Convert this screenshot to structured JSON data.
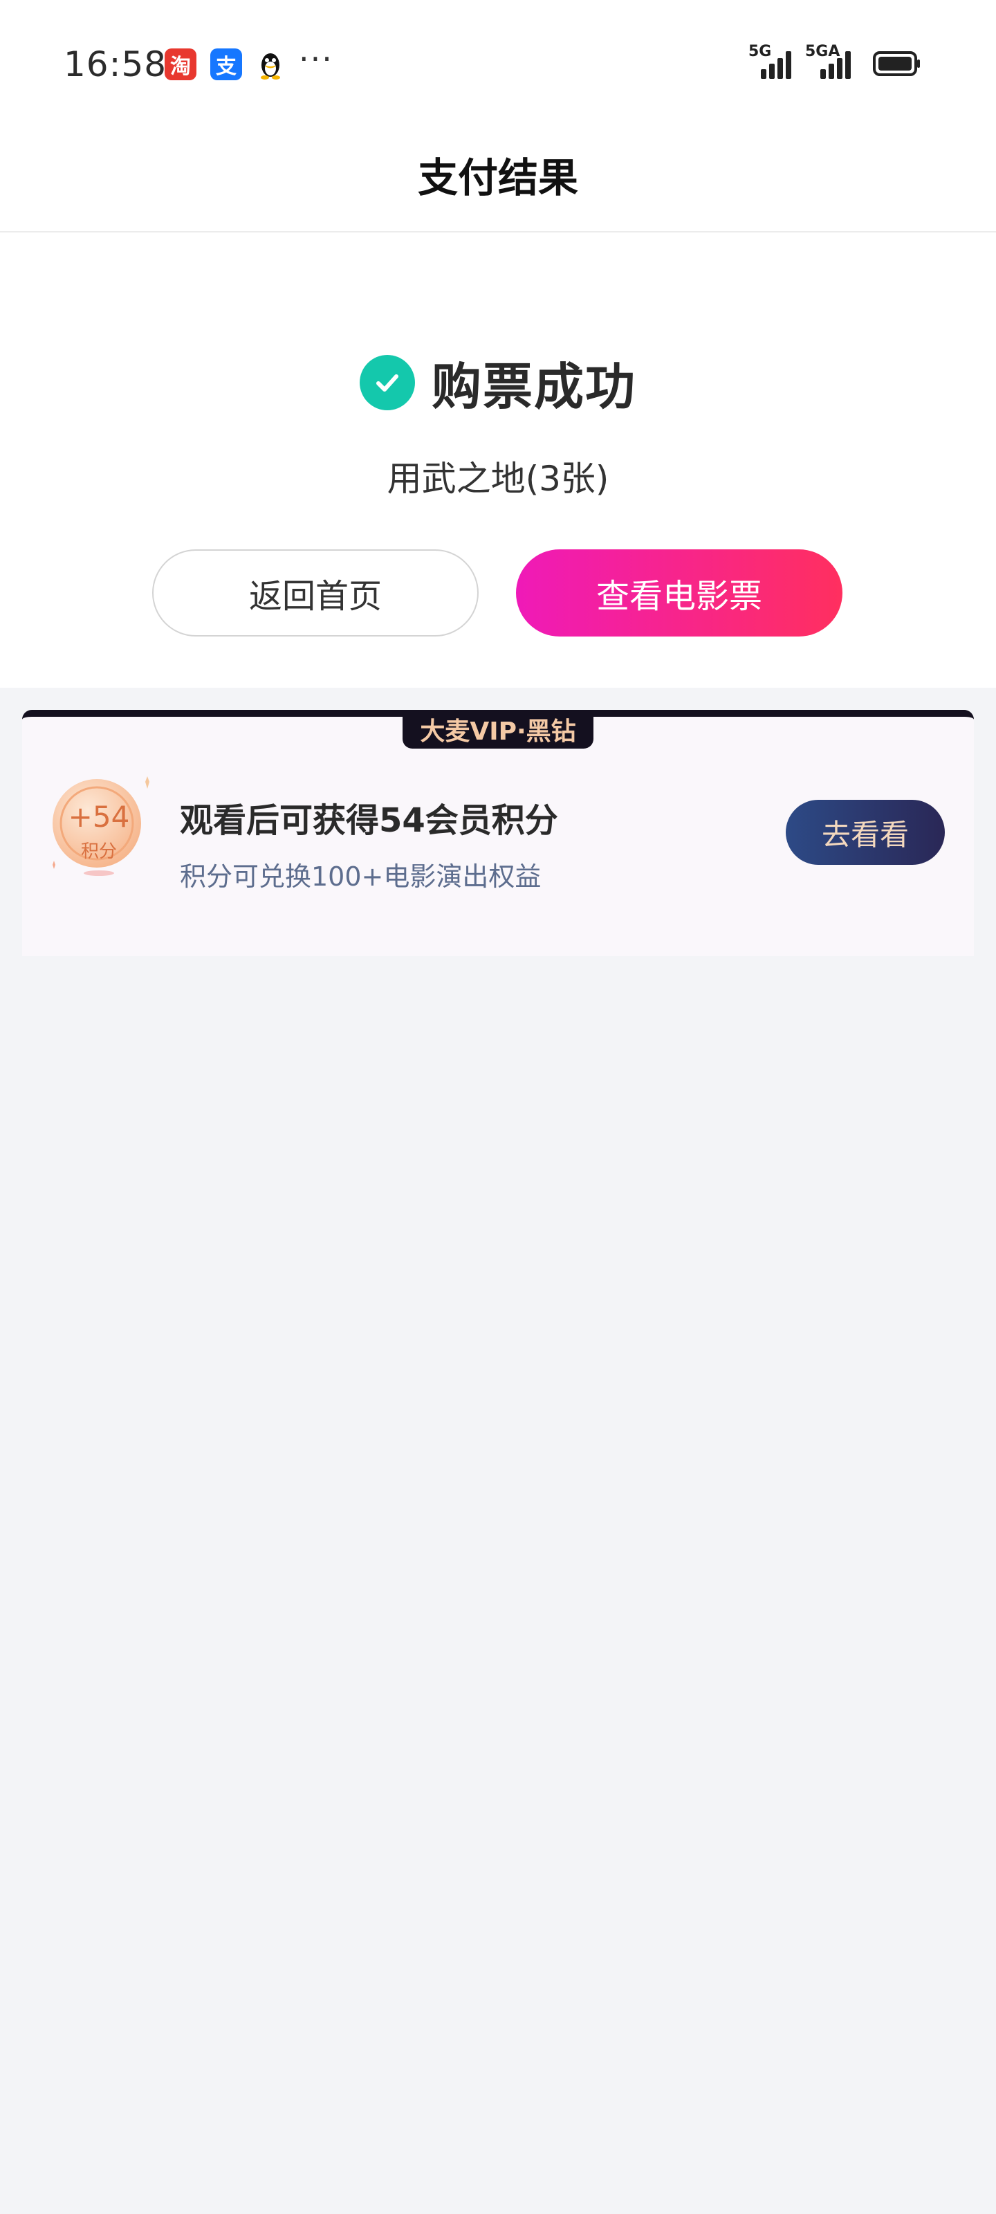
{
  "status_bar": {
    "time": "16:58",
    "app_icons": [
      "taobao-icon",
      "alipay-icon",
      "qq-icon"
    ],
    "more": "···",
    "network_1": "5G",
    "network_2": "5GA"
  },
  "header": {
    "title": "支付结果"
  },
  "result": {
    "status_text": "购票成功",
    "movie_info": "用武之地(3张)",
    "home_button": "返回首页",
    "ticket_button": "查看电影票"
  },
  "vip_card": {
    "tag": "大麦VIP·黑钻",
    "coin_points": "+54",
    "coin_label": "积分",
    "title": "观看后可获得54会员积分",
    "subtitle": "积分可兑换100+电影演出权益",
    "button": "去看看"
  },
  "colors": {
    "success": "#14c8ac",
    "primary_gradient_start": "#ef1ab8",
    "primary_gradient_end": "#ff2f5f",
    "vip_dark": "#14101f",
    "vip_button": "#2a2756"
  }
}
